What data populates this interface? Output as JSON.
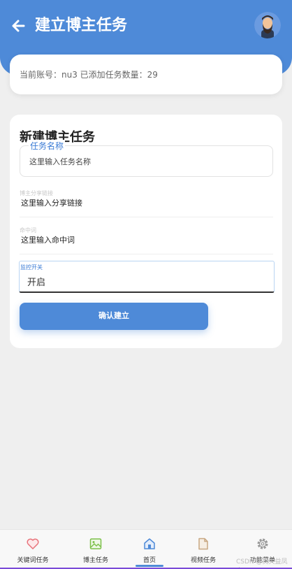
{
  "header": {
    "title": "建立博主任务"
  },
  "info": {
    "text": "当前账号：nu3 已添加任务数量：29"
  },
  "form": {
    "title": "新建博主任务",
    "task_name": {
      "label": "任务名称",
      "placeholder": "这里输入任务名称"
    },
    "share_link": {
      "label": "博主分享链接",
      "placeholder": "这里输入分享链接"
    },
    "hit_word": {
      "label": "命中词",
      "placeholder": "这里输入命中词"
    },
    "monitor": {
      "label": "监控开关",
      "value": "开启"
    },
    "confirm_label": "确认建立"
  },
  "tabs": [
    {
      "label": "关键词任务",
      "icon": "heart-icon",
      "color": "#e8737b"
    },
    {
      "label": "博主任务",
      "icon": "image-icon",
      "color": "#7cc04a"
    },
    {
      "label": "首页",
      "icon": "home-icon",
      "color": "#4e8ad8",
      "active": true
    },
    {
      "label": "视频任务",
      "icon": "document-icon",
      "color": "#c8a782"
    },
    {
      "label": "功能菜单",
      "icon": "gear-icon",
      "color": "#9a9a9a"
    }
  ],
  "watermark": "CSDN @灵天益凤客",
  "colors": {
    "accent": "#4e8ad8",
    "background": "#efefef"
  }
}
